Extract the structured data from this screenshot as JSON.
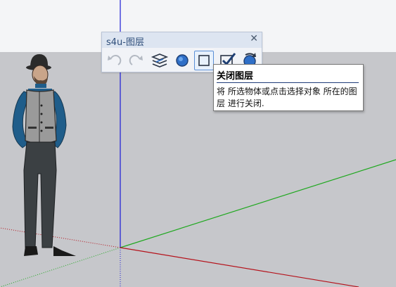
{
  "toolbar": {
    "title": "s4u-图层",
    "close_glyph": "✕",
    "buttons": [
      {
        "name": "undo-icon",
        "enabled": false
      },
      {
        "name": "redo-icon",
        "enabled": false
      },
      {
        "name": "layers-icon",
        "enabled": true
      },
      {
        "name": "layer-on-icon",
        "enabled": true
      },
      {
        "name": "layer-off-icon",
        "enabled": true,
        "active": true
      },
      {
        "name": "layer-check-icon",
        "enabled": true
      },
      {
        "name": "layer-flip-icon",
        "enabled": true
      }
    ]
  },
  "tooltip": {
    "title": "关闭图层",
    "description": "将 所选物体或点击选择对象 所在的图层 进行关闭."
  },
  "colors": {
    "ground": "#c6c7cb",
    "sky": "#f4f5f7",
    "axis_blue": "#1a1ad6",
    "axis_green": "#1fa81f",
    "axis_red": "#b5121b",
    "accent": "#2f6fc7"
  }
}
